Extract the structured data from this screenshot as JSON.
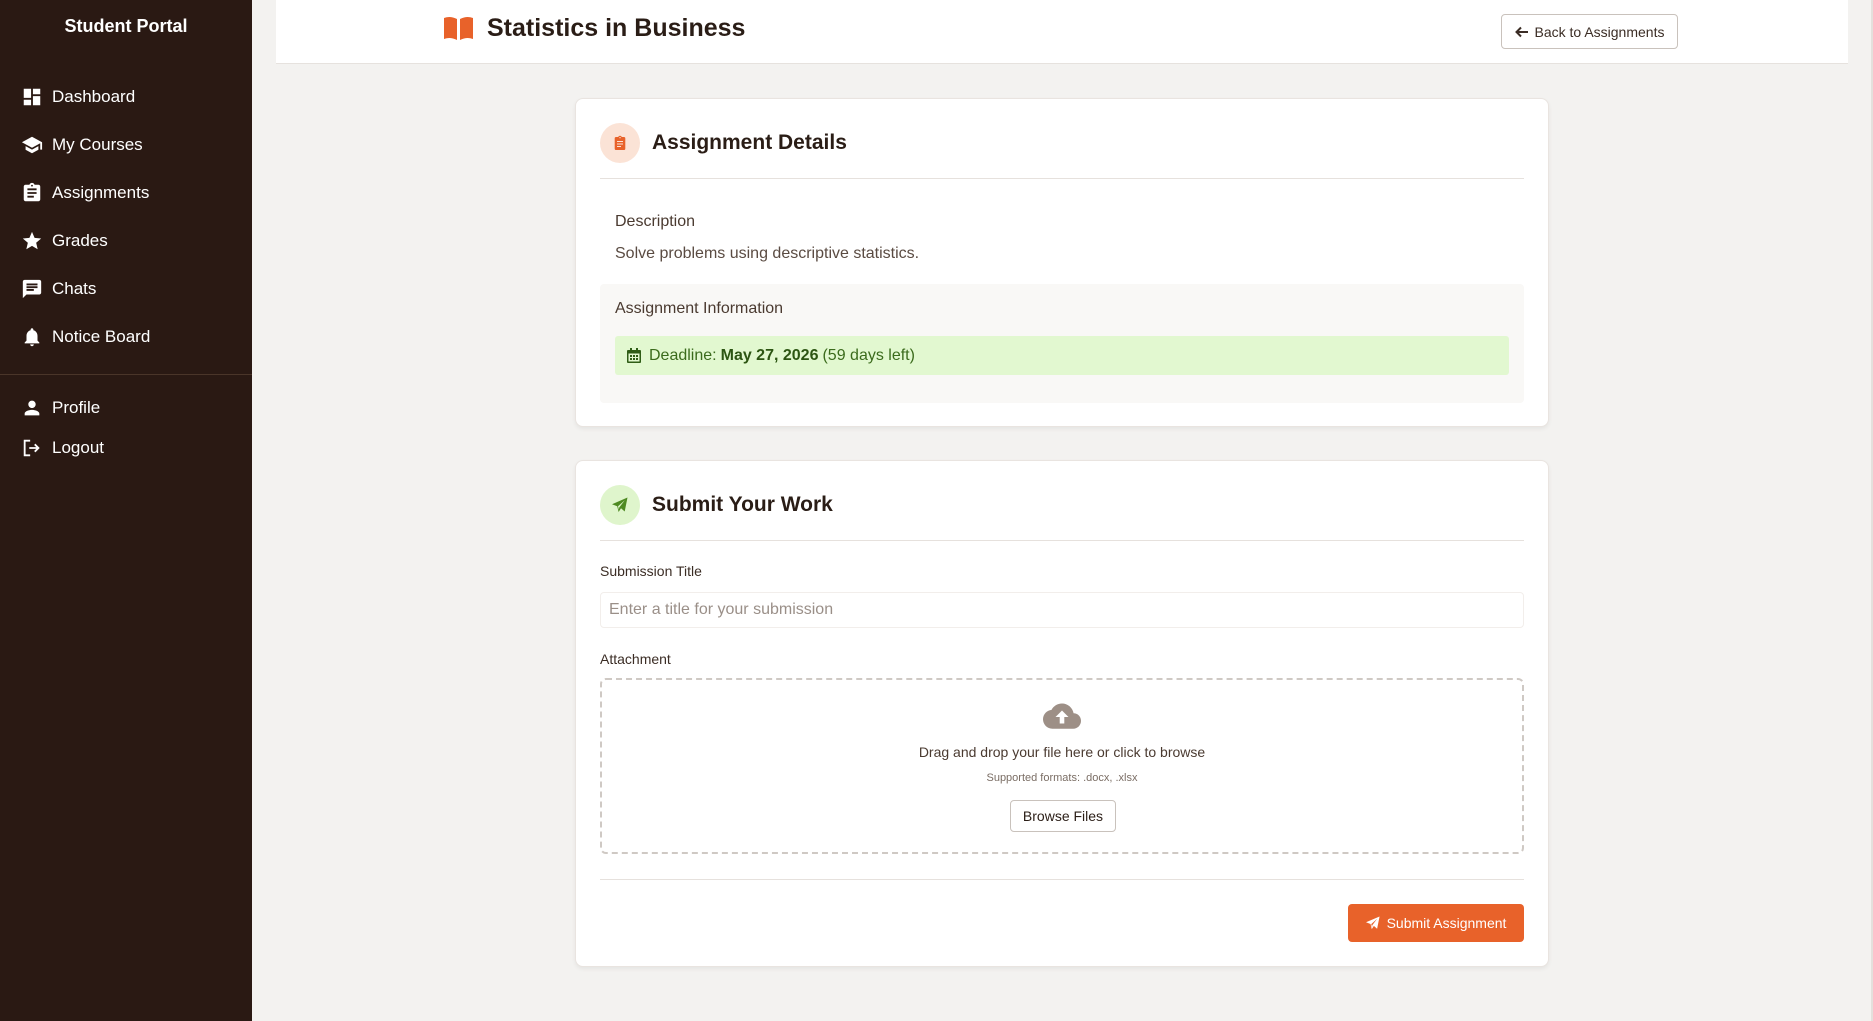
{
  "sidebar": {
    "brand": "Student Portal",
    "items": [
      {
        "label": "Dashboard",
        "icon": "dashboard-icon"
      },
      {
        "label": "My Courses",
        "icon": "graduation-cap-icon"
      },
      {
        "label": "Assignments",
        "icon": "clipboard-icon"
      },
      {
        "label": "Grades",
        "icon": "star-icon"
      },
      {
        "label": "Chats",
        "icon": "chat-icon"
      },
      {
        "label": "Notice Board",
        "icon": "bell-icon"
      }
    ],
    "account_items": [
      {
        "label": "Profile",
        "icon": "person-icon"
      },
      {
        "label": "Logout",
        "icon": "logout-icon"
      }
    ]
  },
  "header": {
    "title": "Statistics in Business",
    "back_label": "Back to Assignments"
  },
  "details": {
    "title": "Assignment Details",
    "description_label": "Description",
    "description": "Solve problems using descriptive statistics.",
    "info_label": "Assignment Information",
    "deadline_prefix": "Deadline:",
    "deadline_date": "May 27, 2026",
    "deadline_remaining": "(59 days left)"
  },
  "submit": {
    "title": "Submit Your Work",
    "title_label": "Submission Title",
    "title_placeholder": "Enter a title for your submission",
    "title_value": "",
    "attachment_label": "Attachment",
    "drop_text": "Drag and drop your file here or click to browse",
    "formats": "Supported formats: .docx, .xlsx",
    "browse_label": "Browse Files",
    "submit_label": "Submit Assignment"
  },
  "colors": {
    "sidebar_bg": "#2a1913",
    "accent": "#e8622a",
    "deadline_bg": "#e2f8d0",
    "deadline_text": "#3b6b1c",
    "page_bg": "#f3f2f0"
  }
}
